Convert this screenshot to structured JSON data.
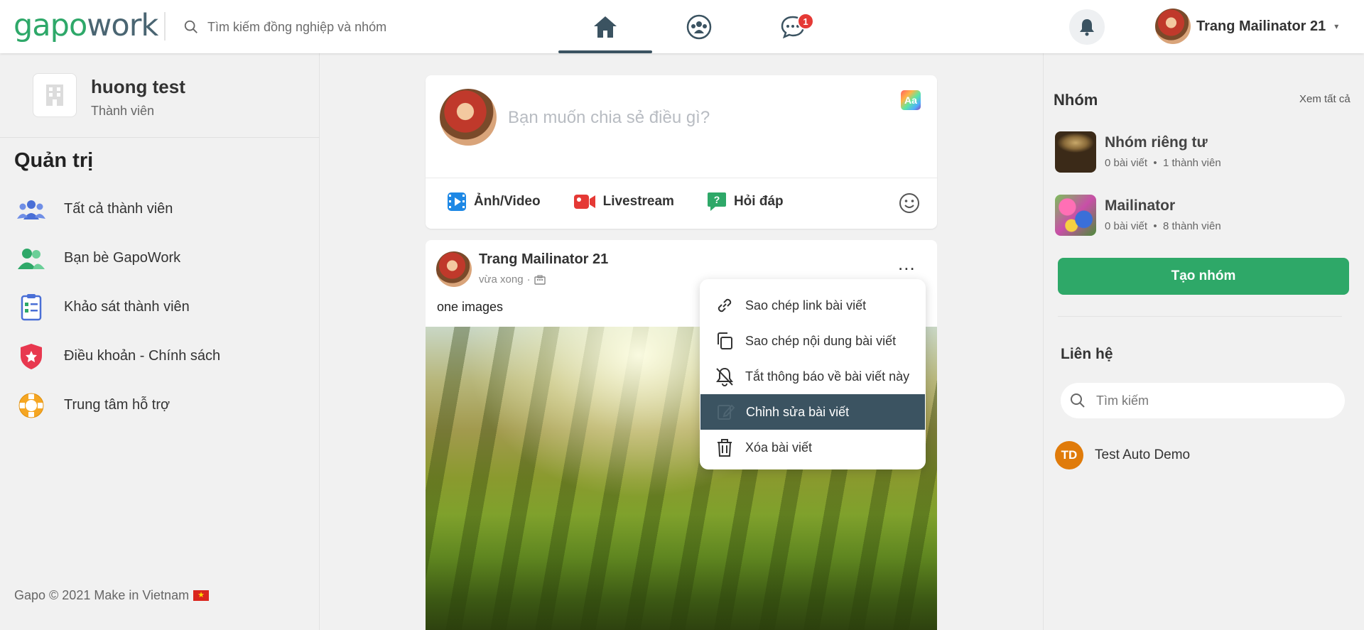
{
  "header": {
    "logo_part1": "gapo",
    "logo_part2": "work",
    "search_placeholder": "Tìm kiếm đồng nghiệp và nhóm",
    "messages_badge": "1",
    "user_name": "Trang Mailinator 21",
    "caret": "▾"
  },
  "sidebar": {
    "org_name": "huong test",
    "org_role": "Thành viên",
    "admin_title": "Quản trị",
    "items": [
      {
        "label": "Tất cả thành viên",
        "icon": "users-icon"
      },
      {
        "label": "Bạn bè GapoWork",
        "icon": "friends-icon"
      },
      {
        "label": "Khảo sát thành viên",
        "icon": "survey-icon"
      },
      {
        "label": "Điều khoản - Chính sách",
        "icon": "shield-icon"
      },
      {
        "label": "Trung tâm hỗ trợ",
        "icon": "lifebuoy-icon"
      }
    ],
    "footer": "Gapo © 2021 Make in Vietnam"
  },
  "composer": {
    "placeholder": "Bạn muốn chia sẻ điều gì?",
    "format_label": "Aa",
    "actions": [
      {
        "label": "Ảnh/Video",
        "icon": "photo-video-icon",
        "color": "#1e88e5"
      },
      {
        "label": "Livestream",
        "icon": "livestream-icon",
        "color": "#e53935"
      },
      {
        "label": "Hỏi đáp",
        "icon": "qa-icon",
        "color": "#2ea868"
      }
    ]
  },
  "post": {
    "author": "Trang Mailinator 21",
    "time": "vừa xong",
    "content": "one images",
    "more": "..."
  },
  "post_menu": {
    "items": [
      {
        "label": "Sao chép link bài viết",
        "icon": "link-icon"
      },
      {
        "label": "Sao chép nội dung bài viết",
        "icon": "copy-icon"
      },
      {
        "label": "Tắt thông báo về bài viết này",
        "icon": "bell-off-icon"
      },
      {
        "label": "Chỉnh sửa bài viết",
        "icon": "edit-icon",
        "active": true
      },
      {
        "label": "Xóa bài viết",
        "icon": "trash-icon"
      }
    ],
    "active_color": "#3b5361"
  },
  "groups": {
    "title": "Nhóm",
    "see_all": "Xem tất cả",
    "items": [
      {
        "name": "Nhóm riêng tư",
        "posts": "0 bài viết",
        "members": "1 thành viên"
      },
      {
        "name": "Mailinator",
        "posts": "0 bài viết",
        "members": "8 thành viên"
      }
    ],
    "create_label": "Tạo nhóm",
    "accent": "#2ea868"
  },
  "contacts": {
    "title": "Liên hệ",
    "search_placeholder": "Tìm kiếm",
    "items": [
      {
        "initials": "TD",
        "name": "Test Auto Demo"
      }
    ]
  }
}
